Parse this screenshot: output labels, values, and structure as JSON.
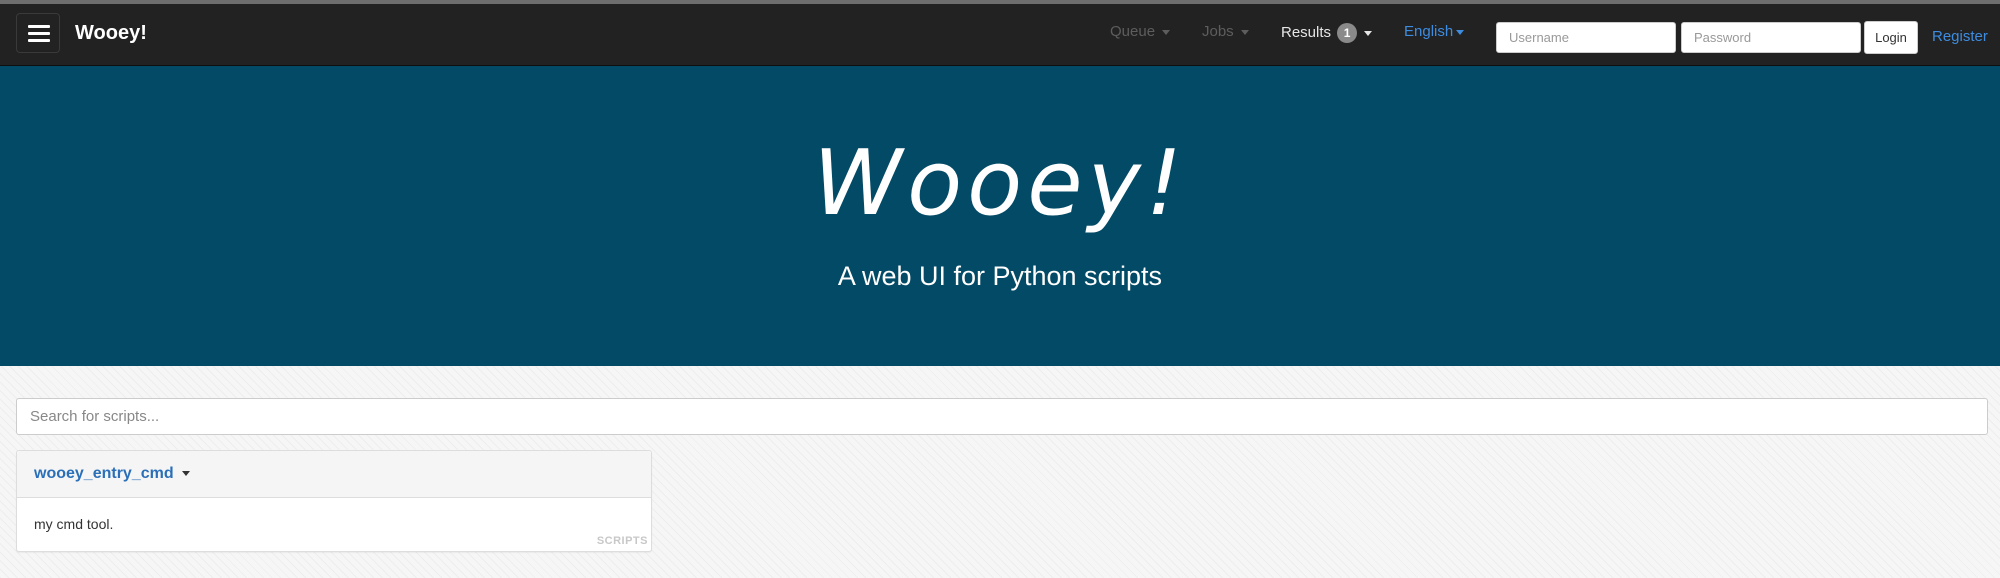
{
  "navbar": {
    "brand": "Wooey!",
    "menu_icon": "hamburger-menu-icon",
    "items": [
      {
        "label": "Queue",
        "state": "disabled"
      },
      {
        "label": "Jobs",
        "state": "disabled"
      },
      {
        "label": "Results",
        "state": "active",
        "badge": "1"
      }
    ],
    "language": "English",
    "username_placeholder": "Username",
    "password_placeholder": "Password",
    "login_label": "Login",
    "register_label": "Register"
  },
  "hero": {
    "title": "Wooey!",
    "subtitle": "A web UI for Python scripts"
  },
  "search": {
    "placeholder": "Search for scripts..."
  },
  "scripts": [
    {
      "name": "wooey_entry_cmd",
      "description": "my cmd tool.",
      "tag": "SCRIPTS"
    }
  ],
  "colors": {
    "navbar_bg": "#222222",
    "hero_bg": "#024a65",
    "link": "#3d8ce0",
    "script_title": "#2a6fb8"
  }
}
